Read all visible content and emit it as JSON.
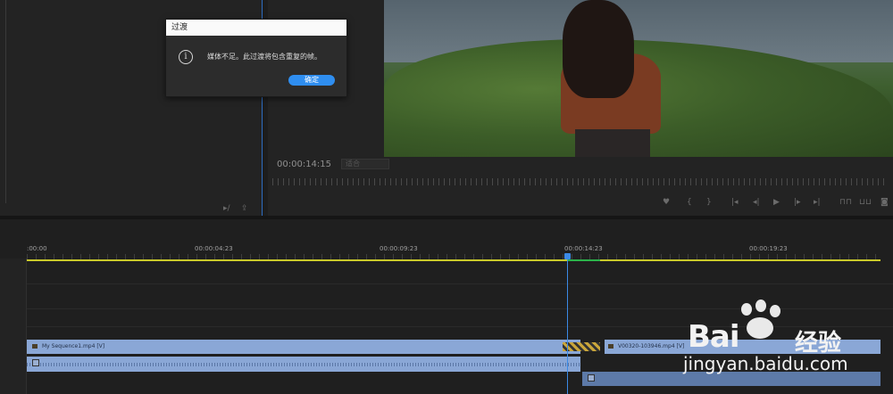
{
  "dialog": {
    "title": "过渡",
    "message": "媒体不足。此过渡将包含重复的帧。",
    "ok_label": "确定"
  },
  "program_monitor": {
    "timecode": "00:00:14:15",
    "fit_label": "适合"
  },
  "timeline": {
    "ruler_labels": [
      ":00:00",
      "00:00:04:23",
      "00:00:09:23",
      "00:00:14:23",
      "00:00:19:23"
    ],
    "clips": {
      "v1_clip_a": "My Sequence1.mp4 [V]",
      "v1_clip_b": "V00320-103946.mp4 [V]"
    }
  },
  "watermark": {
    "brand": "Bai",
    "brand_cn": "经验",
    "url": "jingyan.baidu.com"
  },
  "colors": {
    "accent": "#2f8ef0",
    "playhead": "#3b8ae6",
    "clip": "#8aa7d6",
    "work_area": "#c9c92a"
  }
}
